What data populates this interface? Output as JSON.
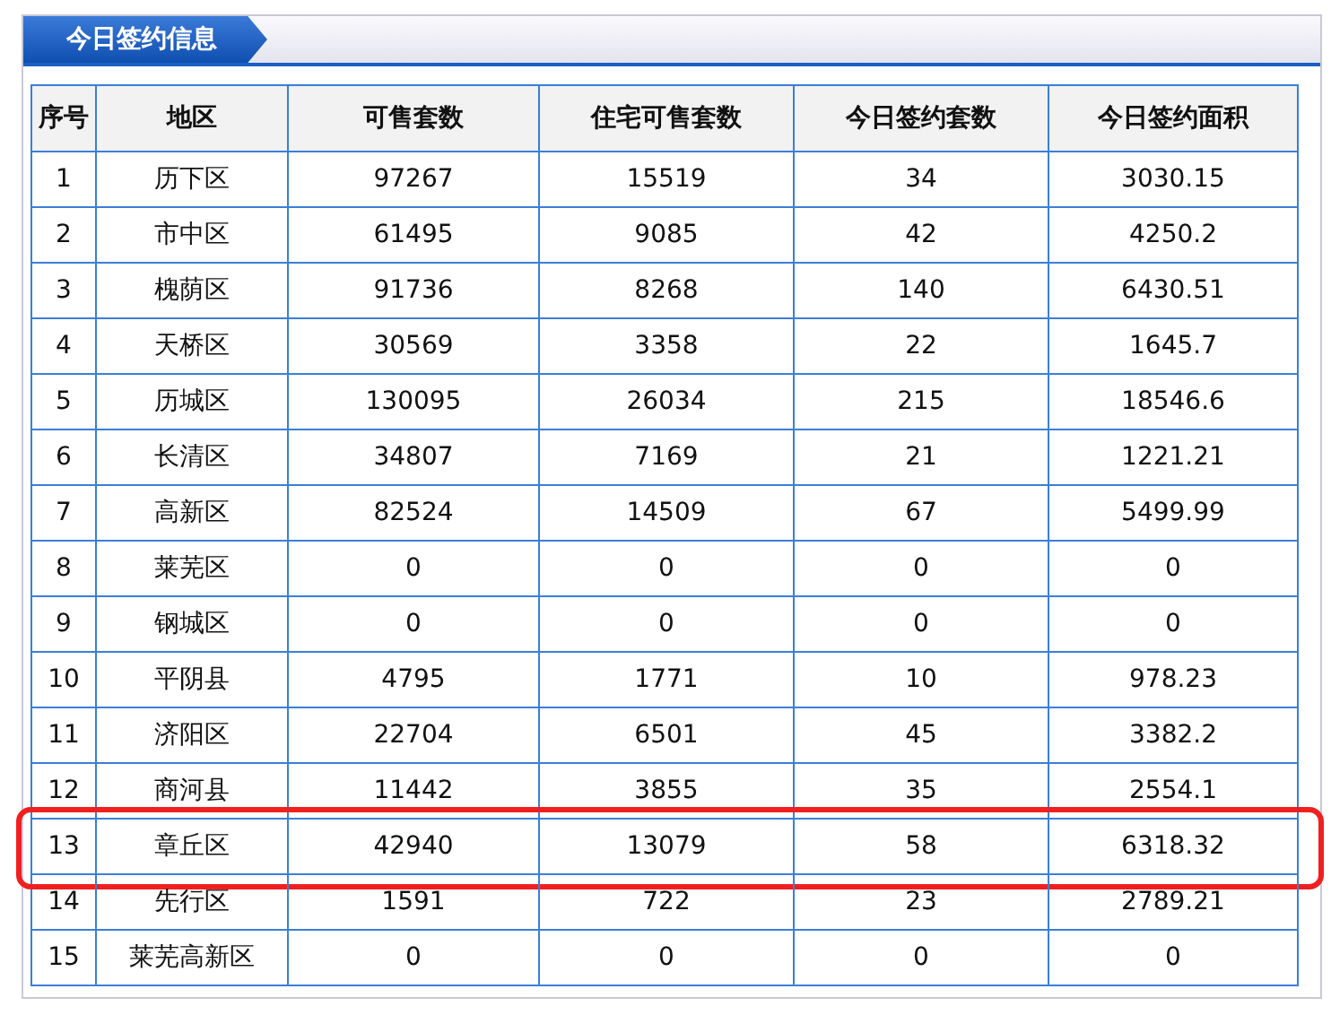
{
  "panel": {
    "title": "今日签约信息"
  },
  "table": {
    "columns": [
      "序号",
      "地区",
      "可售套数",
      "住宅可售套数",
      "今日签约套数",
      "今日签约面积"
    ],
    "rows": [
      {
        "cells": [
          "1",
          "历下区",
          "97267",
          "15519",
          "34",
          "3030.15"
        ],
        "highlighted": false
      },
      {
        "cells": [
          "2",
          "市中区",
          "61495",
          "9085",
          "42",
          "4250.2"
        ],
        "highlighted": false
      },
      {
        "cells": [
          "3",
          "槐荫区",
          "91736",
          "8268",
          "140",
          "6430.51"
        ],
        "highlighted": false
      },
      {
        "cells": [
          "4",
          "天桥区",
          "30569",
          "3358",
          "22",
          "1645.7"
        ],
        "highlighted": false
      },
      {
        "cells": [
          "5",
          "历城区",
          "130095",
          "26034",
          "215",
          "18546.6"
        ],
        "highlighted": false
      },
      {
        "cells": [
          "6",
          "长清区",
          "34807",
          "7169",
          "21",
          "1221.21"
        ],
        "highlighted": false
      },
      {
        "cells": [
          "7",
          "高新区",
          "82524",
          "14509",
          "67",
          "5499.99"
        ],
        "highlighted": false
      },
      {
        "cells": [
          "8",
          "莱芜区",
          "0",
          "0",
          "0",
          "0"
        ],
        "highlighted": false
      },
      {
        "cells": [
          "9",
          "钢城区",
          "0",
          "0",
          "0",
          "0"
        ],
        "highlighted": false
      },
      {
        "cells": [
          "10",
          "平阴县",
          "4795",
          "1771",
          "10",
          "978.23"
        ],
        "highlighted": false
      },
      {
        "cells": [
          "11",
          "济阳区",
          "22704",
          "6501",
          "45",
          "3382.2"
        ],
        "highlighted": false
      },
      {
        "cells": [
          "12",
          "商河县",
          "11442",
          "3855",
          "35",
          "2554.1"
        ],
        "highlighted": false
      },
      {
        "cells": [
          "13",
          "章丘区",
          "42940",
          "13079",
          "58",
          "6318.32"
        ],
        "highlighted": true
      },
      {
        "cells": [
          "14",
          "先行区",
          "1591",
          "722",
          "23",
          "2789.21"
        ],
        "highlighted": false
      },
      {
        "cells": [
          "15",
          "莱芜高新区",
          "0",
          "0",
          "0",
          "0"
        ],
        "highlighted": false
      }
    ]
  }
}
